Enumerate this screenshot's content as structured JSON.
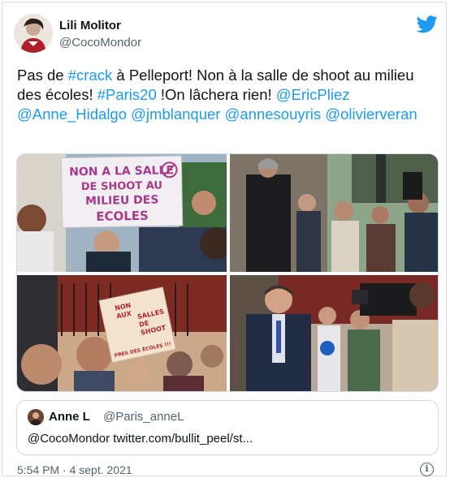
{
  "author": {
    "name": "Lili Molitor",
    "handle": "@CocoMondor"
  },
  "icons": {
    "platform": "twitter-bird-icon",
    "info": "info-icon"
  },
  "colors": {
    "link": "#1d9bf0",
    "brand": "#1d9bf0",
    "secondary_text": "#536471"
  },
  "tweet": {
    "t1": "Pas de ",
    "l1": "#crack",
    "t2": " à Pelleport! Non à la salle de shoot au milieu des écoles! ",
    "l2": "#Paris20",
    "t3": " !On lâchera rien!  ",
    "l3": "@EricPliez",
    "l4": "@Anne_Hidalgo",
    "l5": "@jmblanquer",
    "l6": "@annesouyris",
    "l7": "@olivierveran"
  },
  "media": {
    "sign1": [
      "NON A LA SALLE",
      "DE SHOOT AU",
      "MILIEU DES",
      "ECOLES"
    ],
    "sign2": [
      "NON",
      "AUX",
      "SALLES",
      "DE",
      "SHOOT",
      "PRES DES ÉCOLES !!!"
    ]
  },
  "quote": {
    "name": "Anne L",
    "handle": "@Paris_anneL",
    "text": "@CocoMondor twitter.com/bullit_peel/st..."
  },
  "footer": {
    "timestamp": "5:54 PM · 4 sept. 2021",
    "info_glyph": "i"
  }
}
